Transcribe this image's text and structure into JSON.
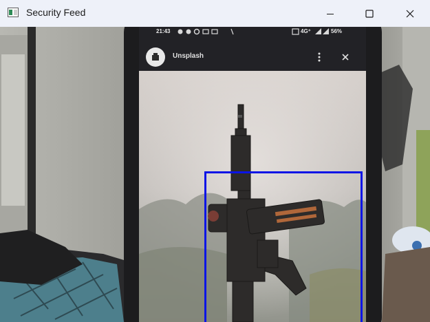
{
  "window": {
    "title": "Security Feed",
    "controls": [
      "minimize",
      "maximize",
      "close"
    ]
  },
  "feed": {
    "phone_status": {
      "time": "21:43",
      "signal": "4G⁺",
      "battery": "56%"
    },
    "app_header": {
      "name": "Unsplash"
    },
    "detection": {
      "box_color": "#0a14e6"
    }
  }
}
